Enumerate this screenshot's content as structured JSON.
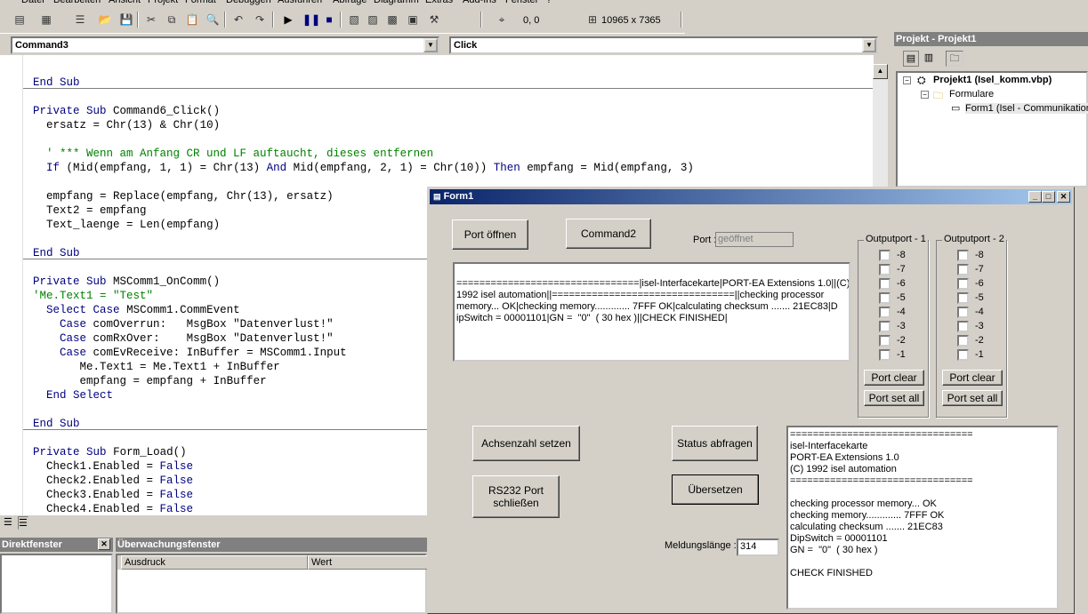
{
  "menu": [
    "Datei",
    "Bearbeiten",
    "Ansicht",
    "Projekt",
    "Format",
    "Debuggen",
    "Ausführen",
    "Abfrage",
    "Diagramm",
    "Extras",
    "Add-Ins",
    "Fenster",
    "?"
  ],
  "toolbar": {
    "position": "0, 0",
    "size": "10965 x 7365"
  },
  "editor": {
    "object_combo": "Command3",
    "proc_combo": "Click",
    "lines": [
      {
        "t": "End Sub",
        "k": "kw"
      },
      {
        "t": "",
        "k": ""
      },
      {
        "t": "Private Sub Command6_Click()",
        "k": "mix"
      },
      {
        "t": "  ersatz = Chr(13) & Chr(10)",
        "k": ""
      },
      {
        "t": "",
        "k": ""
      },
      {
        "t": "  ' *** Wenn am Anfang CR und LF auftaucht, dieses entfernen",
        "k": "cm"
      },
      {
        "t": "  If (Mid(empfang, 1, 1) = Chr(13) And Mid(empfang, 2, 1) = Chr(10)) Then empfang = Mid(empfang, 3)",
        "k": ""
      },
      {
        "t": "",
        "k": ""
      },
      {
        "t": "  empfang = Replace(empfang, Chr(13), ersatz)",
        "k": ""
      },
      {
        "t": "  Text2 = empfang",
        "k": ""
      },
      {
        "t": "  Text_laenge = Len(empfang)",
        "k": ""
      },
      {
        "t": "",
        "k": ""
      },
      {
        "t": "End Sub",
        "k": "kw"
      },
      {
        "t": "",
        "k": ""
      },
      {
        "t": "Private Sub MSComm1_OnComm()",
        "k": "mix"
      },
      {
        "t": "'Me.Text1 = \"Test\"",
        "k": "cm"
      },
      {
        "t": "  Select Case MSComm1.CommEvent",
        "k": ""
      },
      {
        "t": "    Case comOverrun:   MsgBox \"Datenverlust!\"",
        "k": ""
      },
      {
        "t": "    Case comRxOver:    MsgBox \"Datenverlust!\"",
        "k": ""
      },
      {
        "t": "    Case comEvReceive: InBuffer = MSComm1.Input",
        "k": ""
      },
      {
        "t": "       Me.Text1 = Me.Text1 + InBuffer",
        "k": ""
      },
      {
        "t": "       empfang = empfang + InBuffer",
        "k": ""
      },
      {
        "t": "  End Select",
        "k": "kw"
      },
      {
        "t": "",
        "k": ""
      },
      {
        "t": "End Sub",
        "k": "kw"
      },
      {
        "t": "",
        "k": ""
      },
      {
        "t": "Private Sub Form_Load()",
        "k": "mix"
      },
      {
        "t": "  Check1.Enabled = False",
        "k": ""
      },
      {
        "t": "  Check2.Enabled = False",
        "k": ""
      },
      {
        "t": "  Check3.Enabled = False",
        "k": ""
      },
      {
        "t": "  Check4.Enabled = False",
        "k": ""
      }
    ]
  },
  "panels": {
    "immediate_title": "Direktfenster",
    "watch_title": "Überwachungsfenster",
    "watch_col1": "Ausdruck",
    "watch_col2": "Wert"
  },
  "project": {
    "title": "Projekt - Projekt1",
    "root": "Projekt1 (Isel_komm.vbp)",
    "folder": "Formulare",
    "form": "Form1 (Isel - Communikation"
  },
  "form1": {
    "title": "Form1",
    "btn_port_open": "Port öffnen",
    "btn_command2": "Command2",
    "port_label": "Port :",
    "port_value": "geöffnet",
    "text1": "================================|isel-Interfacekarte|PORT-EA Extensions 1.0||(C)\n1992 isel automation||================================||checking processor\nmemory... OK|checking memory............. 7FFF OK|calculating checksum ....... 21EC83|D\nipSwitch = 00001101|GN =  \"0\"  ( 30 hex )||CHECK FINISHED|",
    "group1_label": "Outputport - 1",
    "group2_label": "Outputport - 2",
    "bits": [
      "-8",
      "-7",
      "-6",
      "-5",
      "-4",
      "-3",
      "-2",
      "-1"
    ],
    "port_clear": "Port clear",
    "port_set_all": "Port set all",
    "btn_achsen": "Achsenzahl setzen",
    "btn_status": "Status abfragen",
    "btn_rs232": "RS232 Port\nschließen",
    "btn_uebersetzen": "Übersetzen",
    "laenge_label": "Meldungslänge :",
    "laenge_value": "314",
    "text2": "================================\nisel-Interfacekarte\nPORT-EA Extensions 1.0\n(C) 1992 isel automation\n================================\n\nchecking processor memory... OK\nchecking memory............. 7FFF OK\ncalculating checksum ....... 21EC83\nDipSwitch = 00001101\nGN =  \"0\"  ( 30 hex )\n\nCHECK FINISHED"
  }
}
